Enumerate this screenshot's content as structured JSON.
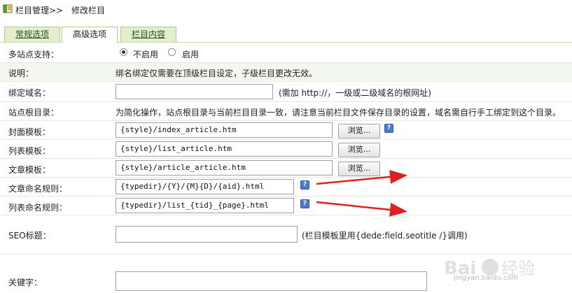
{
  "breadcrumb": {
    "root": "栏目管理",
    "separator": ">>",
    "current": "修改栏目"
  },
  "tabs": [
    {
      "label": "常规选项",
      "active": false
    },
    {
      "label": "高级选项",
      "active": true
    },
    {
      "label": "栏目内容",
      "active": false
    }
  ],
  "multisite": {
    "label": "多站点支持：",
    "options": [
      {
        "label": "不启用",
        "checked": true
      },
      {
        "label": "启用",
        "checked": false
      }
    ]
  },
  "note": {
    "label": "说明：",
    "text": "绑名绑定仅需要在顶级栏目设定，子级栏目更改无效。"
  },
  "domain": {
    "label": "绑定域名：",
    "value": "",
    "hint": "(需加 http://，一级或二级域名的根网址)"
  },
  "site_root": {
    "label": "站点根目录：",
    "text": "为简化操作，站点根目录与当前栏目目录一致，请注意当前栏目文件保存目录的设置，域名需自行手工绑定到这个目录。"
  },
  "templates": [
    {
      "label": "封面模板：",
      "value": "{style}/index_article.htm",
      "button": "浏览...",
      "help": true
    },
    {
      "label": "列表模板：",
      "value": "{style}/list_article.htm",
      "button": "浏览...",
      "help": false
    },
    {
      "label": "文章模板：",
      "value": "{style}/article_article.htm",
      "button": "浏览...",
      "help": false
    }
  ],
  "naming": [
    {
      "label": "文章命名规则：",
      "value": "{typedir}/{Y}/{M}{D}/{aid}.html"
    },
    {
      "label": "列表命名规则：",
      "value": "{typedir}/list_{tid}_{page}.html"
    }
  ],
  "seo": {
    "label": "SEO标题：",
    "value": "",
    "hint": "(栏目模板里用{dede:field.seotitle /}调用)"
  },
  "keywords": {
    "label": "关键字：",
    "value": ""
  },
  "colors": {
    "tab_bg": "#e3eed0",
    "row_shade": "#f4f8ec",
    "arrow": "#e02020",
    "help_icon": "#4a7bd0"
  },
  "watermark": {
    "brand": "Bai 经验",
    "url": "jingyan.baidu.com"
  }
}
